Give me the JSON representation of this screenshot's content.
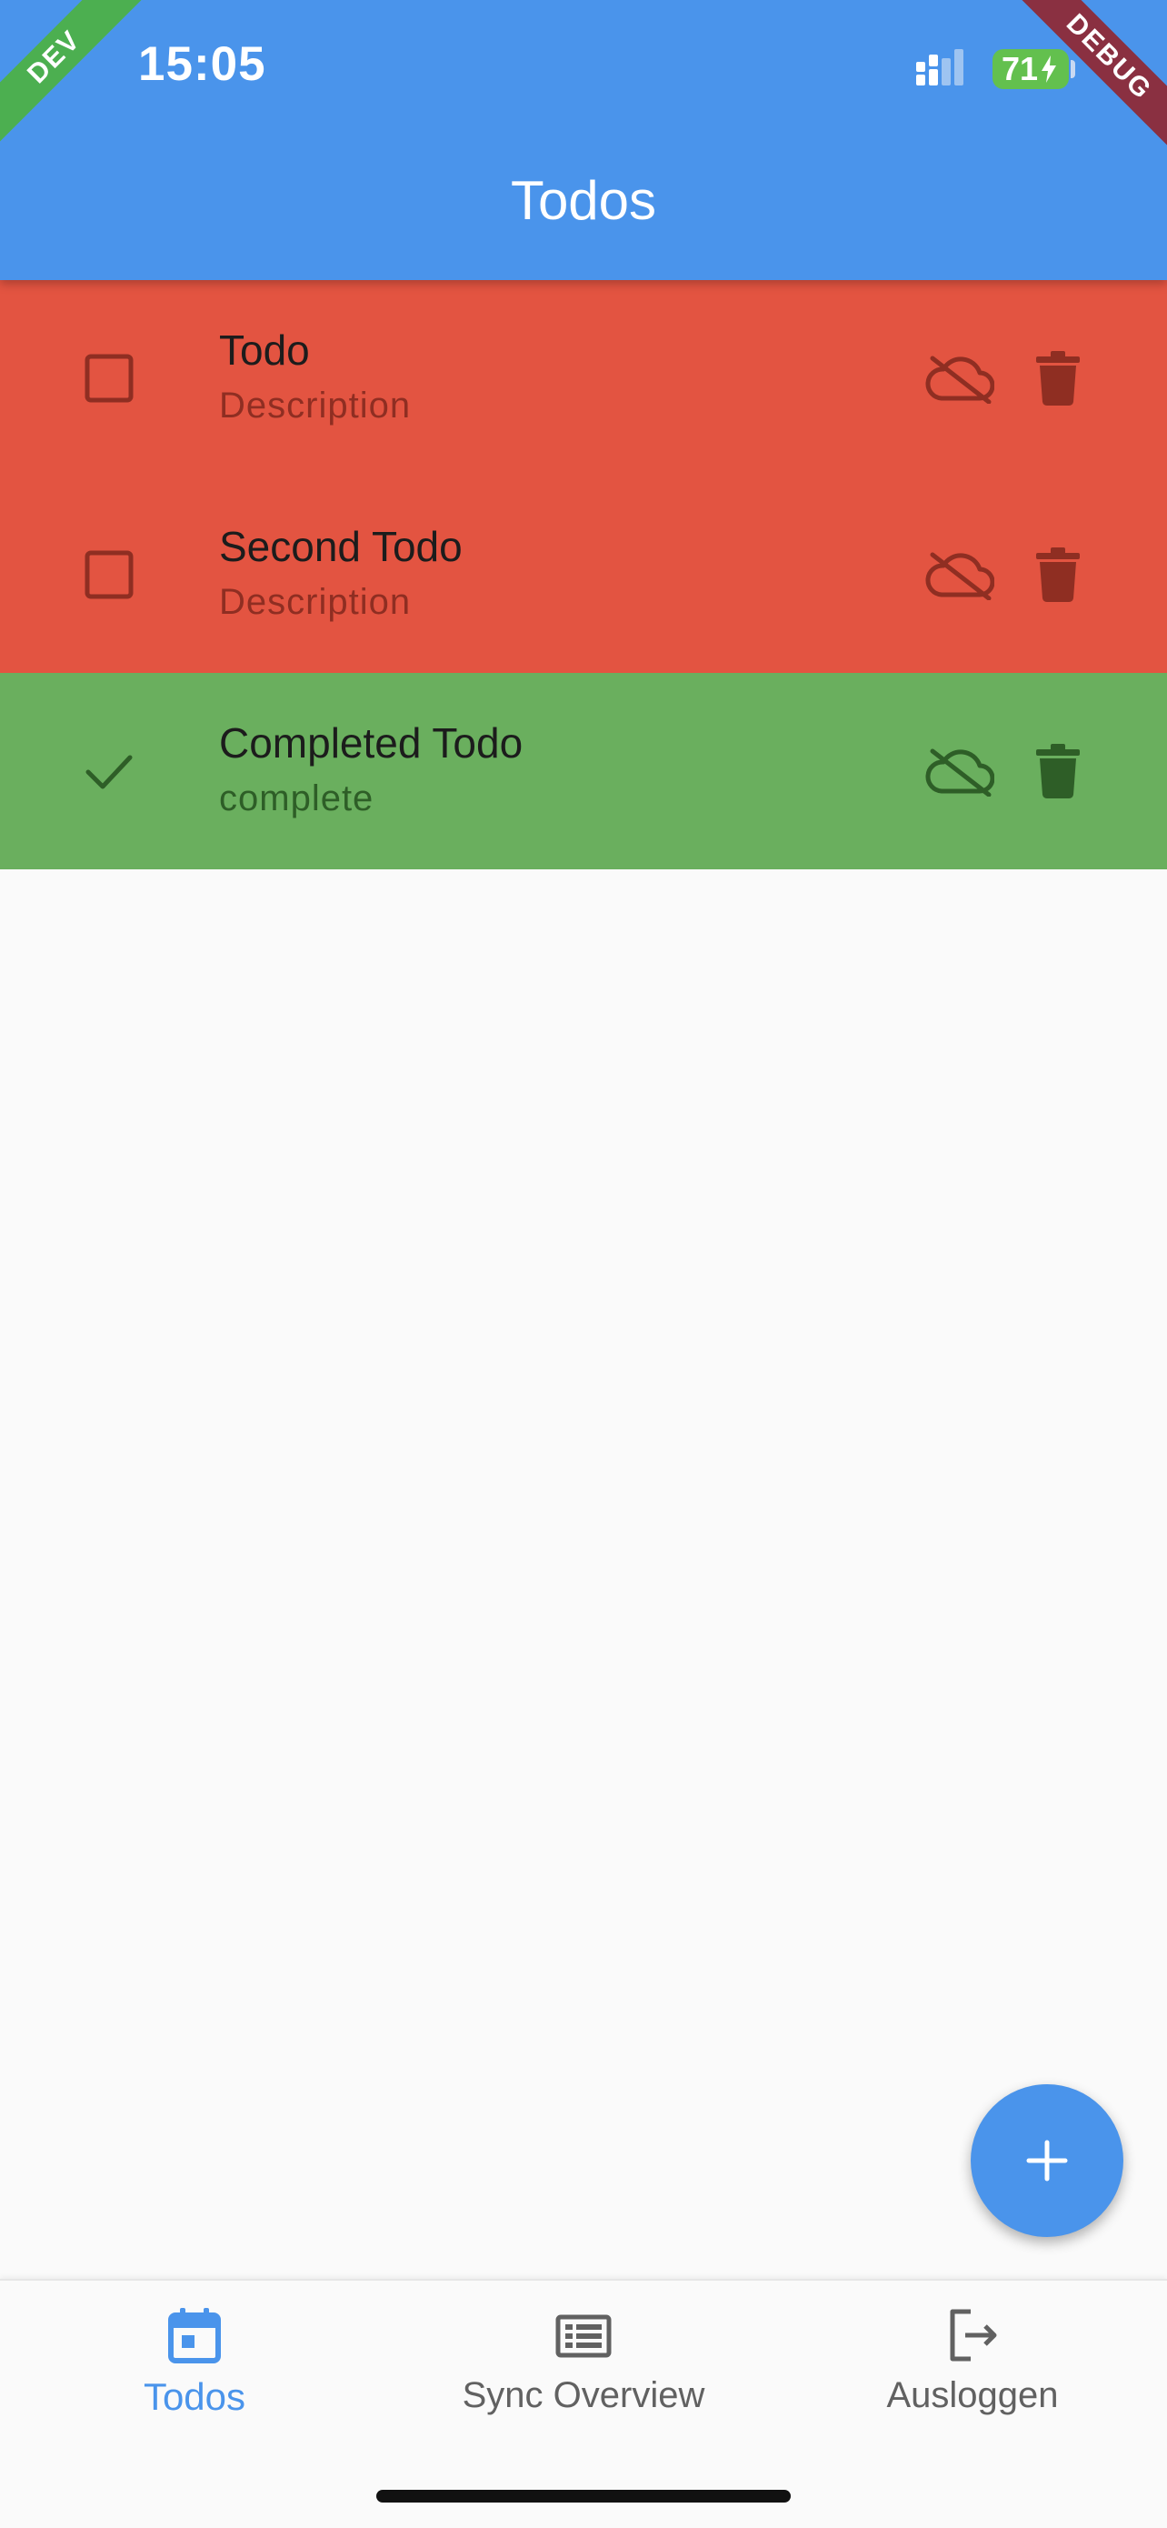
{
  "status_bar": {
    "time": "15:05",
    "battery": "71"
  },
  "ribbons": {
    "left": "DEV",
    "right": "DEBUG"
  },
  "appbar": {
    "title": "Todos"
  },
  "todos": [
    {
      "title": "Todo",
      "description": "Description",
      "completed": false,
      "cloud_icon": "cloud-off-icon",
      "delete_icon": "trash-icon"
    },
    {
      "title": "Second Todo",
      "description": "Description",
      "completed": false,
      "cloud_icon": "cloud-off-icon",
      "delete_icon": "trash-icon"
    },
    {
      "title": "Completed Todo",
      "description": "complete",
      "completed": true,
      "cloud_icon": "cloud-off-icon",
      "delete_icon": "trash-icon"
    }
  ],
  "colors": {
    "primary": "#4a94eb",
    "open_row": "#e35441",
    "done_row": "#6aaf5e",
    "dev_ribbon": "#4caf50",
    "debug_ribbon": "#8a3041"
  },
  "fab": {
    "icon": "plus-icon"
  },
  "bottom_nav": {
    "items": [
      {
        "label": "Todos",
        "icon": "calendar-icon",
        "active": true
      },
      {
        "label": "Sync Overview",
        "icon": "list-icon",
        "active": false
      },
      {
        "label": "Ausloggen",
        "icon": "logout-icon",
        "active": false
      }
    ]
  }
}
